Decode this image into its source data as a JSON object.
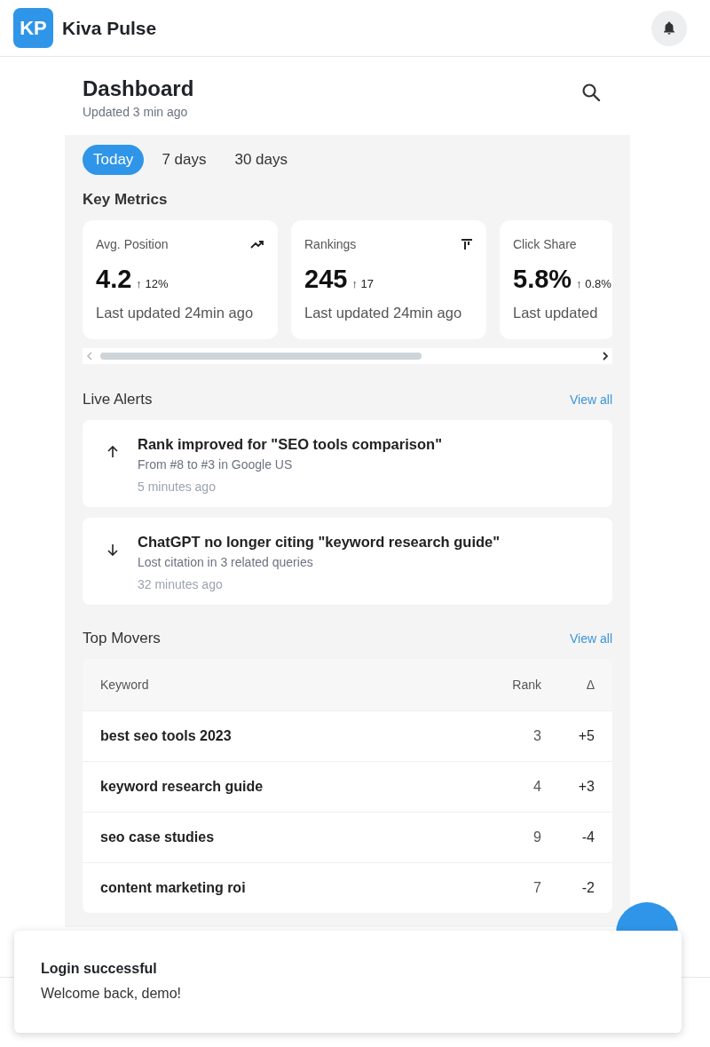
{
  "app": {
    "logo": "KP",
    "name": "Kiva Pulse"
  },
  "page": {
    "title": "Dashboard",
    "subtitle": "Updated 3 min ago"
  },
  "tabs": [
    {
      "label": "Today",
      "selected": true
    },
    {
      "label": "7 days",
      "selected": false
    },
    {
      "label": "30 days",
      "selected": false
    }
  ],
  "key_metrics": {
    "title": "Key Metrics",
    "cards": [
      {
        "label": "Avg. Position",
        "value": "4.2",
        "change": "↑ 12%",
        "footer": "Last updated 24min ago",
        "kind": "trend"
      },
      {
        "label": "Rankings",
        "value": "245",
        "change": "↑ 17",
        "footer": "Last updated 24min ago",
        "kind": "bars"
      },
      {
        "label": "Click Share",
        "value": "5.8%",
        "change": "↑ 0.8%",
        "footer": "Last updated"
      }
    ]
  },
  "live_alerts": {
    "title": "Live Alerts",
    "link": "View all",
    "items": [
      {
        "kind": "up",
        "title": "Rank improved for \"SEO tools comparison\"",
        "detail": "From #8 to #3 in Google US",
        "time": "5 minutes ago"
      },
      {
        "kind": "down",
        "title": "ChatGPT no longer citing \"keyword research guide\"",
        "detail": "Lost citation in 3 related queries",
        "time": "32 minutes ago"
      }
    ]
  },
  "top_movers": {
    "title": "Top Movers",
    "link": "View all",
    "columns": [
      "Keyword",
      "Rank",
      "Δ"
    ],
    "rows": [
      {
        "keyword": "best seo tools 2023",
        "rank": "3",
        "delta": "+5"
      },
      {
        "keyword": "keyword research guide",
        "rank": "4",
        "delta": "+3"
      },
      {
        "keyword": "seo case studies",
        "rank": "9",
        "delta": "-4"
      },
      {
        "keyword": "content marketing roi",
        "rank": "7",
        "delta": "-2"
      }
    ]
  },
  "toast": {
    "title": "Login successful",
    "message": "Welcome back, demo!"
  }
}
